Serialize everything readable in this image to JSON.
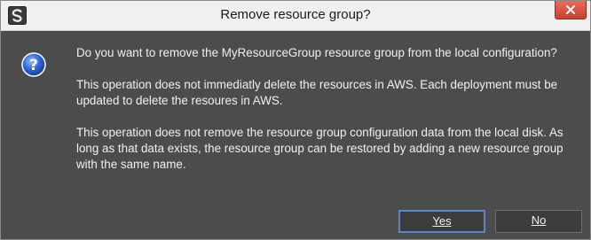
{
  "dialog": {
    "title": "Remove resource group?",
    "icons": {
      "app": "app-logo-icon",
      "close": "close-icon",
      "message": "question-icon"
    },
    "messages": [
      "Do you want to remove the MyResourceGroup resource group from the local configuration?",
      "This operation does not immediatly delete the resources in AWS. Each deployment must be updated to delete the resoures in AWS.",
      "This operation does not remove the resource group configuration data from the local disk. As long as that data exists, the resource group can be restored by adding a new resource group with the same name."
    ],
    "buttons": {
      "yes_label": "Yes",
      "no_label": "No"
    },
    "colors": {
      "background": "#4c4c4c",
      "titlebar": "#f0f0f0",
      "close": "#c7402f",
      "focus_border": "#5a86c4"
    }
  }
}
